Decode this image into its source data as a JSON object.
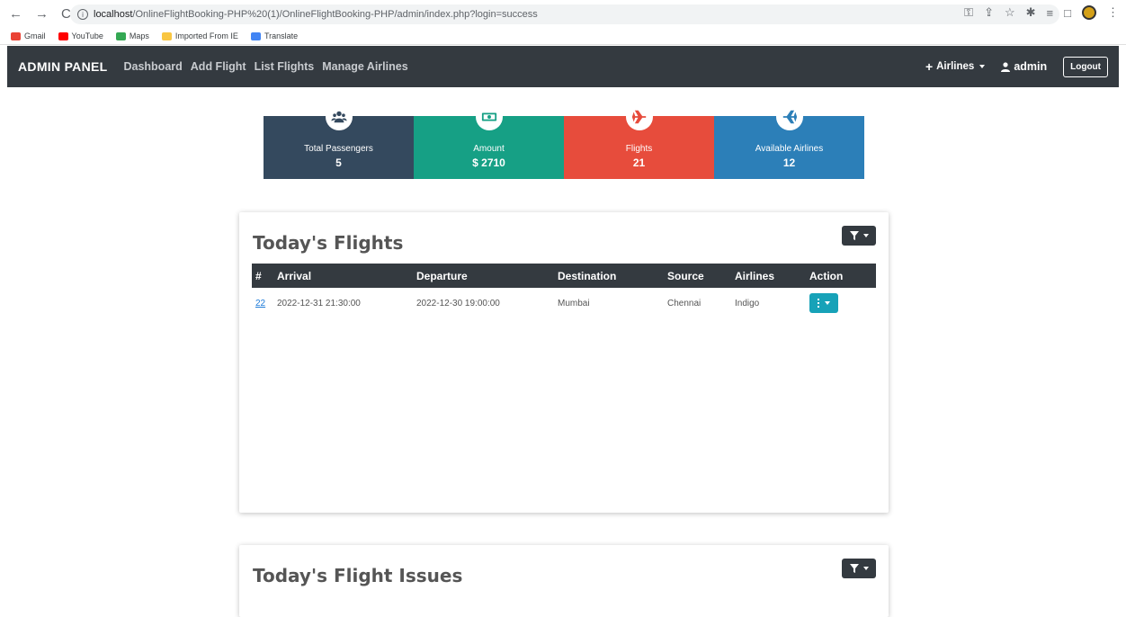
{
  "browser": {
    "url_host": "localhost",
    "url_path": "/OnlineFlightBooking-PHP%20(1)/OnlineFlightBooking-PHP/admin/index.php?login=success",
    "bookmarks": [
      "Gmail",
      "YouTube",
      "Maps",
      "Imported From IE",
      "Translate"
    ]
  },
  "navbar": {
    "brand": "ADMIN PANEL",
    "links": [
      "Dashboard",
      "Add Flight",
      "List Flights",
      "Manage Airlines"
    ],
    "airlines_label": "Airlines",
    "user_label": "admin",
    "logout_label": "Logout"
  },
  "stats": [
    {
      "label": "Total Passengers",
      "value": "5",
      "color": "#34495e",
      "icon": "users-icon"
    },
    {
      "label": "Amount",
      "value": "$ 2710",
      "color": "#16a085",
      "icon": "money-icon"
    },
    {
      "label": "Flights",
      "value": "21",
      "color": "#e74c3c",
      "icon": "plane-icon"
    },
    {
      "label": "Available Airlines",
      "value": "12",
      "color": "#2c7fb8",
      "icon": "plane-icon"
    }
  ],
  "flights": {
    "title": "Today's Flights",
    "columns": [
      "#",
      "Arrival",
      "Departure",
      "Destination",
      "Source",
      "Airlines",
      "Action"
    ],
    "rows": [
      {
        "id": "22",
        "arrival": "2022-12-31 21:30:00",
        "departure": "2022-12-30 19:00:00",
        "destination": "Mumbai",
        "source": "Chennai",
        "airline": "Indigo"
      }
    ]
  },
  "issues": {
    "title": "Today's Flight Issues"
  }
}
